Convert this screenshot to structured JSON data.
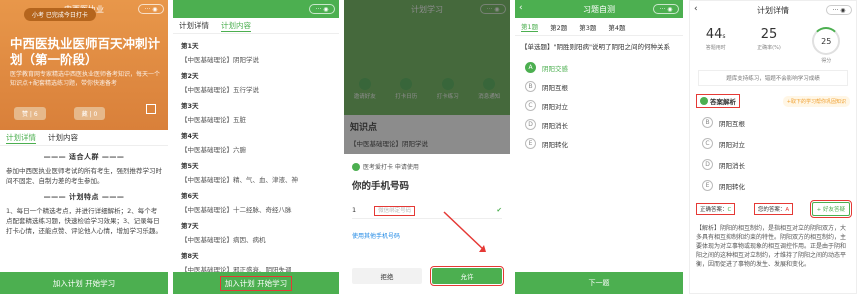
{
  "panel1": {
    "title": "中西医执业",
    "badge": "小考 已完成今日打卡",
    "hero_title": "中西医执业医师百天冲刺计划（第一阶段）",
    "hero_desc": "医学教育网专家精选中西医执业医师备考知识，每天一个知识点+配套精选练习题，带你快速备考",
    "like_label": "赞 | 6",
    "collect_label": "藏 | 0",
    "tabs": [
      "计划详情",
      "计划内容"
    ],
    "sec1": "适合人群",
    "sec1_text": "参加中西医执业医师考试的所有考生，强烈推荐学习时间不固定、自制力差的考生参加。",
    "sec2": "计划特点",
    "sec2_text": "1、每日一个精选考点，并进行详细解析；2、每个考点配套精选练习题，快速检验学习效果；3、记录每日打卡心情，还能点赞、评论他人心情，增加学习乐趣。",
    "join_btn": "加入计划 开始学习"
  },
  "panel2": {
    "tabs": [
      "计划详情",
      "计划内容"
    ],
    "days": [
      {
        "t": "第1天",
        "c": "【中医基础理论】阴阳学说"
      },
      {
        "t": "第2天",
        "c": "【中医基础理论】五行学说"
      },
      {
        "t": "第3天",
        "c": "【中医基础理论】五脏"
      },
      {
        "t": "第4天",
        "c": "【中医基础理论】六腑"
      },
      {
        "t": "第5天",
        "c": "【中医基础理论】精、气、血、津液、神"
      },
      {
        "t": "第6天",
        "c": "【中医基础理论】十二经脉、奇经八脉"
      },
      {
        "t": "第7天",
        "c": "【中医基础理论】病因、病机"
      },
      {
        "t": "第8天",
        "c": "【中医基础理论】邪正盛衰、阴阳失调"
      }
    ],
    "join_btn": "加入计划 开始学习"
  },
  "panel3": {
    "title": "计划学习",
    "icons": [
      "邀请好友",
      "打卡日历",
      "打卡练习",
      "消息通知"
    ],
    "knowledge": "知识点",
    "snippet": "【中医基础理论】阴阳学说",
    "sheet_head": "医考爱打卡 申请使用",
    "sheet_title": "你的手机号码",
    "phone_prefix": "1",
    "phone_mask": "微信绑定号码",
    "other_link": "使用其他手机号码",
    "deny": "拒绝",
    "allow": "允许"
  },
  "panel4": {
    "title": "习题自测",
    "qtabs": [
      "第1题",
      "第2题",
      "第3题",
      "第4题"
    ],
    "question": "【单选题】\"阴胜则阳病\"说明了阴阳之间的何种关系",
    "options": [
      {
        "k": "A",
        "v": "阴阳交感"
      },
      {
        "k": "B",
        "v": "阴阳互根"
      },
      {
        "k": "C",
        "v": "阴阳对立"
      },
      {
        "k": "D",
        "v": "阴阳消长"
      },
      {
        "k": "E",
        "v": "阴阳转化"
      }
    ],
    "next": "下一题"
  },
  "panel5": {
    "title": "计划详情",
    "stats": [
      {
        "v": "44",
        "unit": "s",
        "l": "答题用时"
      },
      {
        "v": "25",
        "unit": "",
        "l": "正确率(%)"
      },
      {
        "v": "25",
        "unit": "",
        "l": "得分"
      }
    ],
    "notice": "题库支持练习，错题不会影响学习成绩",
    "ans_tab": "答案解析",
    "ans_hint": "+取下的学习帮你巩固知识",
    "options": [
      {
        "k": "B",
        "v": "阴阳互根"
      },
      {
        "k": "C",
        "v": "阴阳对立"
      },
      {
        "k": "D",
        "v": "阴阳消长"
      },
      {
        "k": "E",
        "v": "阴阳转化"
      }
    ],
    "correct_label": "正确答案：",
    "correct": "C",
    "your_label": "您的答案：",
    "yours": "A",
    "wrong_btn": "+ 好友答疑",
    "analysis": "【解析】阴阳的相互制约，是指相互对立的阴阳双方，大多具有相互抑制和约束的特性。阴阳双方的相互制约，主要体现为对立事物或现象的相互调控作用。正是由于阴和阳之间的这种相互对立制约，才维持了阴阳之间的动态平衡，因而促进了事物的发生、发展和变化。"
  }
}
